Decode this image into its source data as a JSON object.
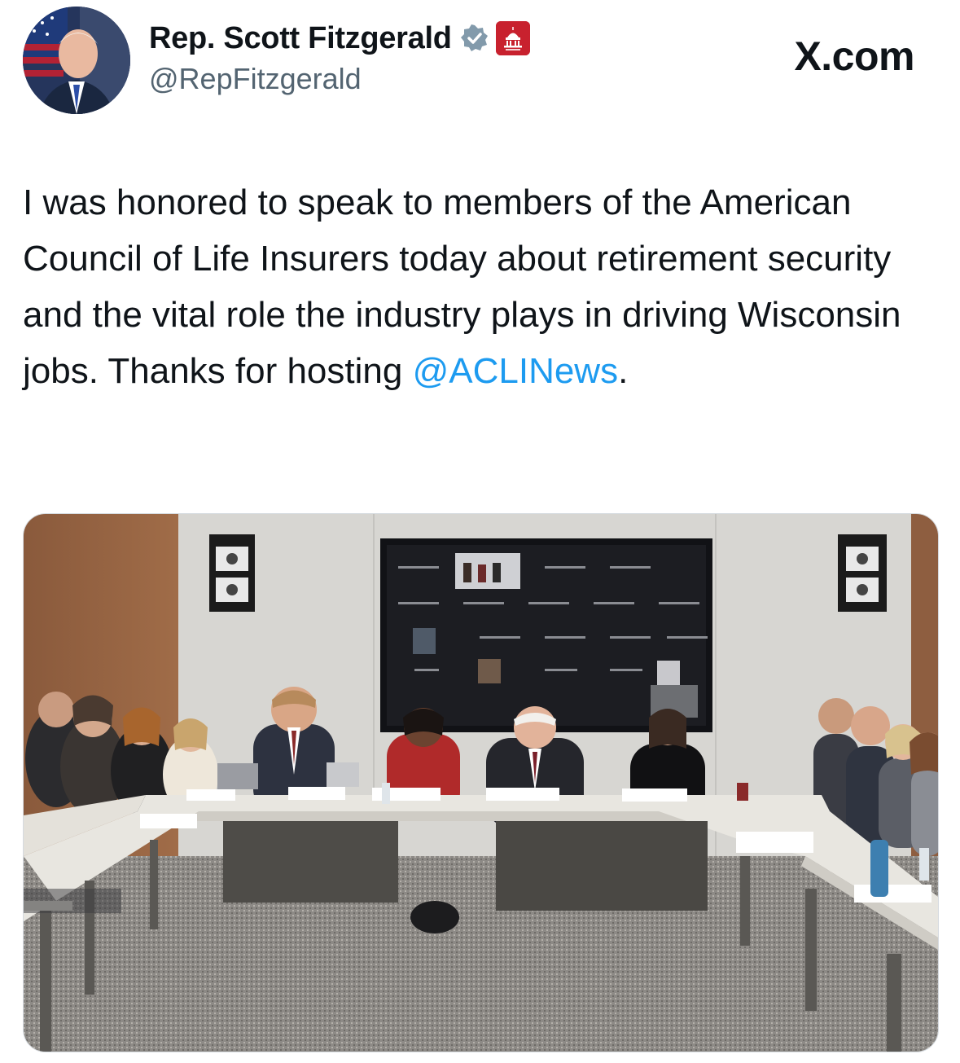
{
  "author": {
    "display_name": "Rep. Scott Fitzgerald",
    "handle": "@RepFitzgerald",
    "verified_icon": "verified-badge-icon",
    "affiliate_badge": "house-gop-badge"
  },
  "site": {
    "label": "X.com"
  },
  "tweet": {
    "text_before_mention": "I was honored to speak to members of the American Council of Life Insurers today about retirement security and the vital role the industry plays in driving Wisconsin jobs. Thanks for hosting ",
    "mention": "@ACLINews",
    "text_after_mention": "."
  },
  "colors": {
    "mention": "#1d9bf0",
    "verified": "#829aab",
    "badge": "#c8212e"
  }
}
